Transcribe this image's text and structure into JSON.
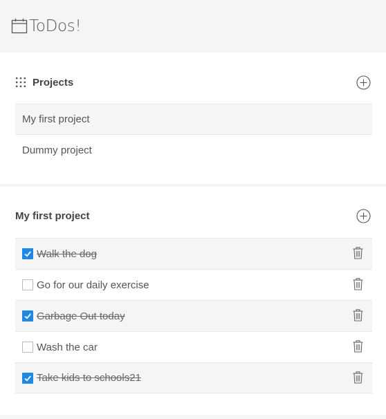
{
  "header": {
    "title": "ToDos!",
    "icon": "calendar-icon"
  },
  "projects": {
    "title": "Projects",
    "items": [
      {
        "label": "My first project",
        "active": true
      },
      {
        "label": "Dummy project",
        "active": false
      }
    ]
  },
  "todos": {
    "title": "My first project",
    "items": [
      {
        "text": "Walk the dog",
        "done": true
      },
      {
        "text": "Go for our daily exercise",
        "done": false
      },
      {
        "text": "Garbage Out today",
        "done": true
      },
      {
        "text": "Wash the car",
        "done": false
      },
      {
        "text": "Take kids to schools21",
        "done": true
      }
    ]
  },
  "colors": {
    "accent": "#1e88e5",
    "background": "#f5f5f5",
    "card": "#ffffff",
    "text": "#444444"
  }
}
